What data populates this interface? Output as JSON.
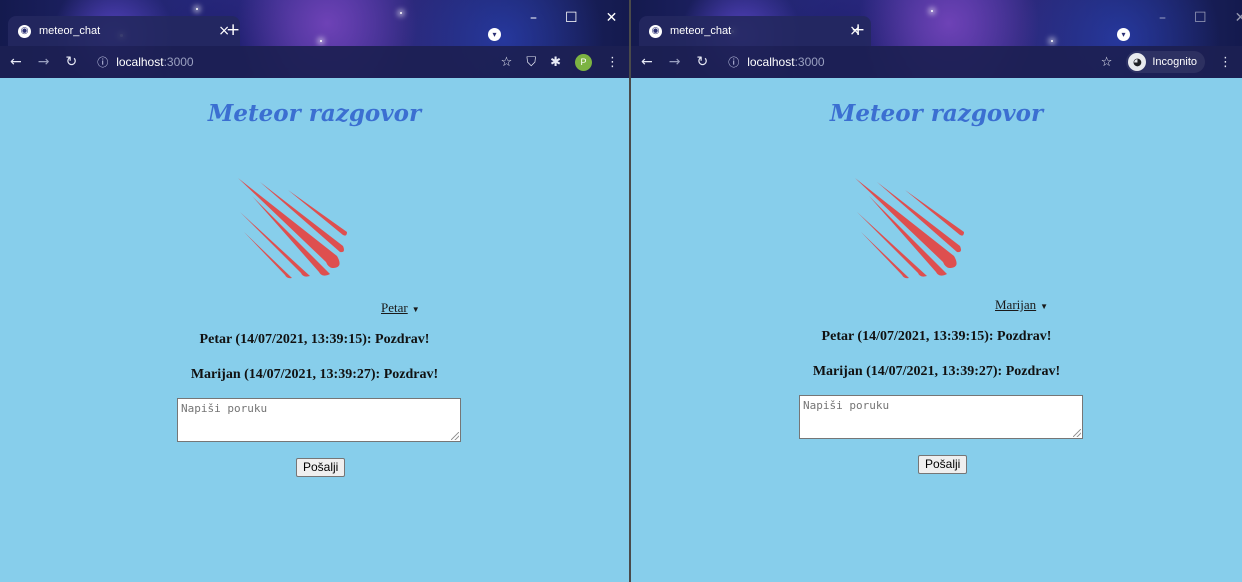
{
  "browser": {
    "tab_title": "meteor_chat",
    "new_tab": "+",
    "url_host": "localhost",
    "url_port": ":3000",
    "window_controls": [
      "–",
      "☐",
      "✕"
    ],
    "profile_initial": "P",
    "incognito_label": "Incognito"
  },
  "page": {
    "title": "Meteor razgovor",
    "send_label": "Pošalji",
    "placeholder": "Napiši poruku",
    "messages": [
      "Petar (14/07/2021, 13:39:15): Pozdrav!",
      "Marijan (14/07/2021, 13:39:27): Pozdrav!"
    ]
  },
  "left": {
    "current_user": "Petar"
  },
  "right": {
    "current_user": "Marijan"
  },
  "colors": {
    "page_bg": "#87CEEB",
    "title": "#3b6fd1",
    "logo": "#de4f4f"
  }
}
